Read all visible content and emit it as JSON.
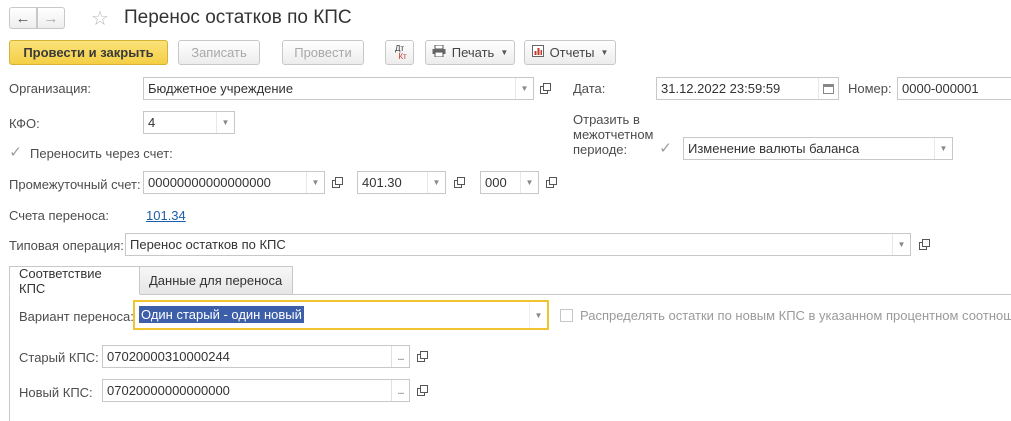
{
  "window": {
    "title": "Перенос остатков по КПС"
  },
  "toolbar": {
    "post_close_label": "Провести и закрыть",
    "save_label": "Записать",
    "post_label": "Провести",
    "dt_kt_label_dt": "Дт",
    "dt_kt_label_kt": "Кт",
    "print_label": "Печать",
    "reports_label": "Отчеты"
  },
  "header": {
    "org_label": "Организация:",
    "org_value": "Бюджетное учреждение",
    "date_label": "Дата:",
    "date_value": "31.12.2022 23:59:59",
    "number_label": "Номер:",
    "number_value": "0000-000001",
    "kfo_label": "КФО:",
    "kfo_value": "4",
    "reflect_label_1": "Отразить в",
    "reflect_label_2": "межотчетном",
    "reflect_label_3": "периоде:",
    "reflect_checked": true,
    "reflect_value": "Изменение валюты баланса",
    "transfer_via_account_label": "Переносить через счет:",
    "transfer_via_account_checked": true,
    "intermediate_account_label": "Промежуточный счет:",
    "intermediate_account_value": "00000000000000000",
    "intermediate_account_code": "401.30",
    "intermediate_account_sub": "000",
    "transfer_accounts_label": "Счета переноса:",
    "transfer_accounts_link": "101.34",
    "typical_operation_label": "Типовая операция:",
    "typical_operation_value": "Перенос остатков по КПС"
  },
  "tabs": [
    {
      "label": "Соответствие КПС",
      "active": true
    },
    {
      "label": "Данные для переноса",
      "active": false
    }
  ],
  "tab_content": {
    "variant_label": "Вариант переноса:",
    "variant_value": "Один старый - один новый",
    "distribute_label": "Распределять остатки по новым КПС в указанном процентном соотнош",
    "distribute_checked": false,
    "old_kps_label": "Старый КПС:",
    "old_kps_value": "07020000310000244",
    "new_kps_label": "Новый КПС:",
    "new_kps_value": "07020000000000000"
  },
  "icons": {
    "back": "arrow-left-icon",
    "forward": "arrow-right-icon",
    "favorite": "star-icon",
    "print": "printer-icon",
    "reports": "chart-icon",
    "open": "open-window-icon",
    "calendar": "calendar-icon"
  },
  "colors": {
    "primary_button": "#f4cf45",
    "focus_border": "#f0c430",
    "selection": "#3d5fa9",
    "link": "#1d5ea9"
  }
}
